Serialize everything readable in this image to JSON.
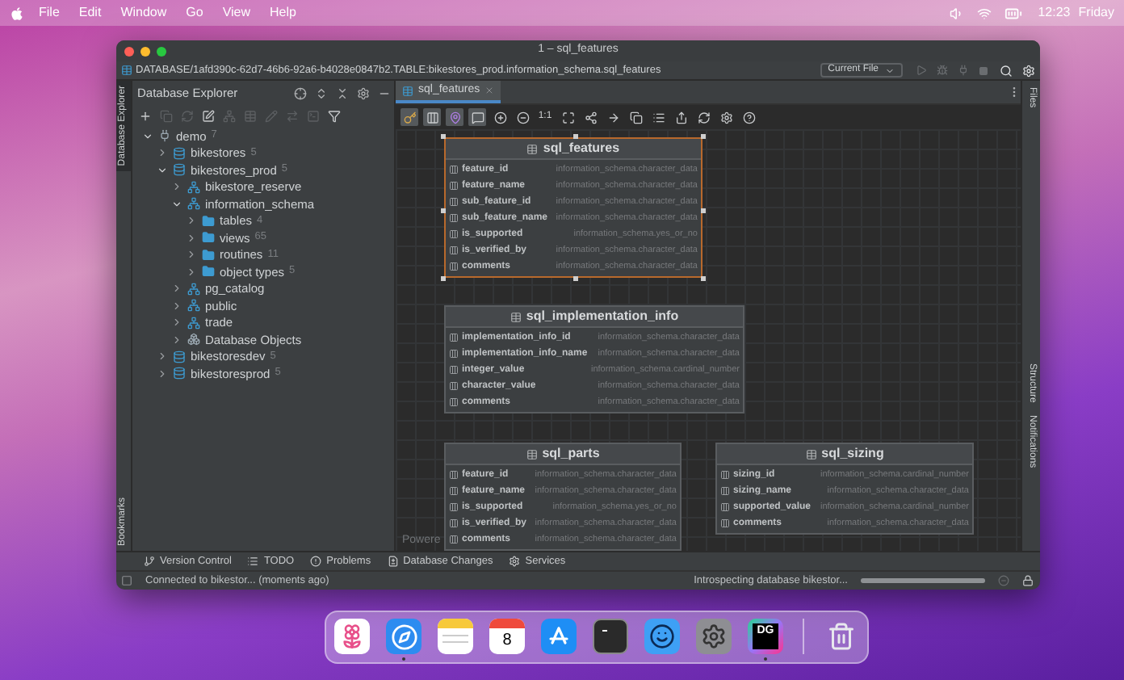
{
  "menu_bar": {
    "items": [
      "File",
      "Edit",
      "Window",
      "Go",
      "View",
      "Help"
    ],
    "time": "12:23",
    "day": "Friday"
  },
  "window": {
    "title": "1 – sql_features",
    "path": "DATABASE/1afd390c-62d7-46b6-92a6-b4028e0847b2.TABLE:bikestores_prod.information_schema.sql_features",
    "scope_dropdown": "Current File"
  },
  "left_strip": [
    {
      "label": "Database Explorer",
      "selected": true
    },
    {
      "label": "Bookmarks",
      "selected": false
    }
  ],
  "right_strip": [
    {
      "label": "Files"
    },
    {
      "label": "Structure"
    },
    {
      "label": "Notifications"
    }
  ],
  "explorer": {
    "title": "Database Explorer",
    "toolbar": [
      {
        "kind": "add",
        "disabled": false
      },
      {
        "kind": "copy",
        "disabled": true
      },
      {
        "kind": "refresh",
        "disabled": true
      },
      {
        "kind": "edit",
        "disabled": false
      },
      {
        "kind": "schema",
        "disabled": true
      },
      {
        "kind": "table",
        "disabled": true
      },
      {
        "kind": "pencil",
        "disabled": true
      },
      {
        "kind": "jump",
        "disabled": true
      },
      {
        "kind": "console",
        "disabled": true
      },
      {
        "kind": "filter",
        "disabled": false
      }
    ],
    "tree": [
      {
        "label": "demo",
        "count": "7",
        "kind": "datasource",
        "expanded": true,
        "children": [
          {
            "label": "bikestores",
            "count": "5",
            "kind": "database",
            "expanded": false
          },
          {
            "label": "bikestores_prod",
            "count": "5",
            "kind": "database",
            "expanded": true,
            "children": [
              {
                "label": "bikestore_reserve",
                "kind": "schema",
                "expanded": false
              },
              {
                "label": "information_schema",
                "kind": "schema",
                "expanded": true,
                "children": [
                  {
                    "label": "tables",
                    "count": "4",
                    "kind": "folder",
                    "expanded": false
                  },
                  {
                    "label": "views",
                    "count": "65",
                    "kind": "folder",
                    "expanded": false
                  },
                  {
                    "label": "routines",
                    "count": "11",
                    "kind": "folder",
                    "expanded": false
                  },
                  {
                    "label": "object types",
                    "count": "5",
                    "kind": "folder",
                    "expanded": false
                  }
                ]
              },
              {
                "label": "pg_catalog",
                "kind": "schema",
                "expanded": false
              },
              {
                "label": "public",
                "kind": "schema",
                "expanded": false
              },
              {
                "label": "trade",
                "kind": "schema",
                "expanded": false
              },
              {
                "label": "Database Objects",
                "kind": "objects",
                "expanded": false
              }
            ]
          },
          {
            "label": "bikestoresdev",
            "count": "5",
            "kind": "database",
            "expanded": false
          },
          {
            "label": "bikestoresprod",
            "count": "5",
            "kind": "database",
            "expanded": false
          }
        ]
      }
    ]
  },
  "editor": {
    "tabs": [
      {
        "label": "sql_features",
        "selected": true
      }
    ],
    "toolbar": [
      {
        "kind": "key",
        "on": true
      },
      {
        "kind": "columns",
        "on": true
      },
      {
        "kind": "pin",
        "on": true
      },
      {
        "kind": "comment",
        "on": true
      },
      {
        "kind": "zoom_in",
        "on": false
      },
      {
        "kind": "zoom_out",
        "on": false
      },
      {
        "kind": "text",
        "label": "1:1",
        "on": false
      },
      {
        "kind": "fit",
        "on": false
      },
      {
        "kind": "share",
        "on": false
      },
      {
        "kind": "arrow",
        "on": false
      },
      {
        "kind": "copy",
        "on": false
      },
      {
        "kind": "list",
        "on": false
      },
      {
        "kind": "export",
        "on": false
      },
      {
        "kind": "refresh",
        "on": false
      },
      {
        "kind": "settings",
        "on": false
      },
      {
        "kind": "help",
        "on": false
      }
    ],
    "canvas_note": "Powere",
    "tables": [
      {
        "name": "sql_features",
        "selected": true,
        "columns": [
          {
            "name": "feature_id",
            "type": "information_schema.character_data"
          },
          {
            "name": "feature_name",
            "type": "information_schema.character_data"
          },
          {
            "name": "sub_feature_id",
            "type": "information_schema.character_data"
          },
          {
            "name": "sub_feature_name",
            "type": "information_schema.character_data"
          },
          {
            "name": "is_supported",
            "type": "information_schema.yes_or_no"
          },
          {
            "name": "is_verified_by",
            "type": "information_schema.character_data"
          },
          {
            "name": "comments",
            "type": "information_schema.character_data"
          }
        ]
      },
      {
        "name": "sql_implementation_info",
        "selected": false,
        "columns": [
          {
            "name": "implementation_info_id",
            "type": "information_schema.character_data"
          },
          {
            "name": "implementation_info_name",
            "type": "information_schema.character_data"
          },
          {
            "name": "integer_value",
            "type": "information_schema.cardinal_number"
          },
          {
            "name": "character_value",
            "type": "information_schema.character_data"
          },
          {
            "name": "comments",
            "type": "information_schema.character_data"
          }
        ]
      },
      {
        "name": "sql_parts",
        "selected": false,
        "columns": [
          {
            "name": "feature_id",
            "type": "information_schema.character_data"
          },
          {
            "name": "feature_name",
            "type": "information_schema.character_data"
          },
          {
            "name": "is_supported",
            "type": "information_schema.yes_or_no"
          },
          {
            "name": "is_verified_by",
            "type": "information_schema.character_data"
          },
          {
            "name": "comments",
            "type": "information_schema.character_data"
          }
        ]
      },
      {
        "name": "sql_sizing",
        "selected": false,
        "columns": [
          {
            "name": "sizing_id",
            "type": "information_schema.cardinal_number"
          },
          {
            "name": "sizing_name",
            "type": "information_schema.character_data"
          },
          {
            "name": "supported_value",
            "type": "information_schema.cardinal_number"
          },
          {
            "name": "comments",
            "type": "information_schema.character_data"
          }
        ]
      }
    ]
  },
  "tool_windows": [
    {
      "kind": "vcs",
      "label": "Version Control"
    },
    {
      "kind": "todo",
      "label": "TODO"
    },
    {
      "kind": "problems",
      "label": "Problems"
    },
    {
      "kind": "changes",
      "label": "Database Changes"
    },
    {
      "kind": "services",
      "label": "Services"
    }
  ],
  "status_bar": {
    "message": "Connected to bikestor... (moments ago)",
    "task": "Introspecting database bikestor...",
    "level": 1
  },
  "dock": [
    {
      "kind": "photos",
      "running": false
    },
    {
      "kind": "safari",
      "running": true
    },
    {
      "kind": "notes",
      "running": false
    },
    {
      "kind": "calendar",
      "label": "8",
      "running": false
    },
    {
      "kind": "appstore",
      "running": false
    },
    {
      "kind": "terminal",
      "running": false
    },
    {
      "kind": "finder",
      "running": false
    },
    {
      "kind": "settings",
      "running": false
    },
    {
      "kind": "datagrip",
      "label": "DG",
      "running": true
    },
    {
      "kind": "trash",
      "running": false
    }
  ]
}
